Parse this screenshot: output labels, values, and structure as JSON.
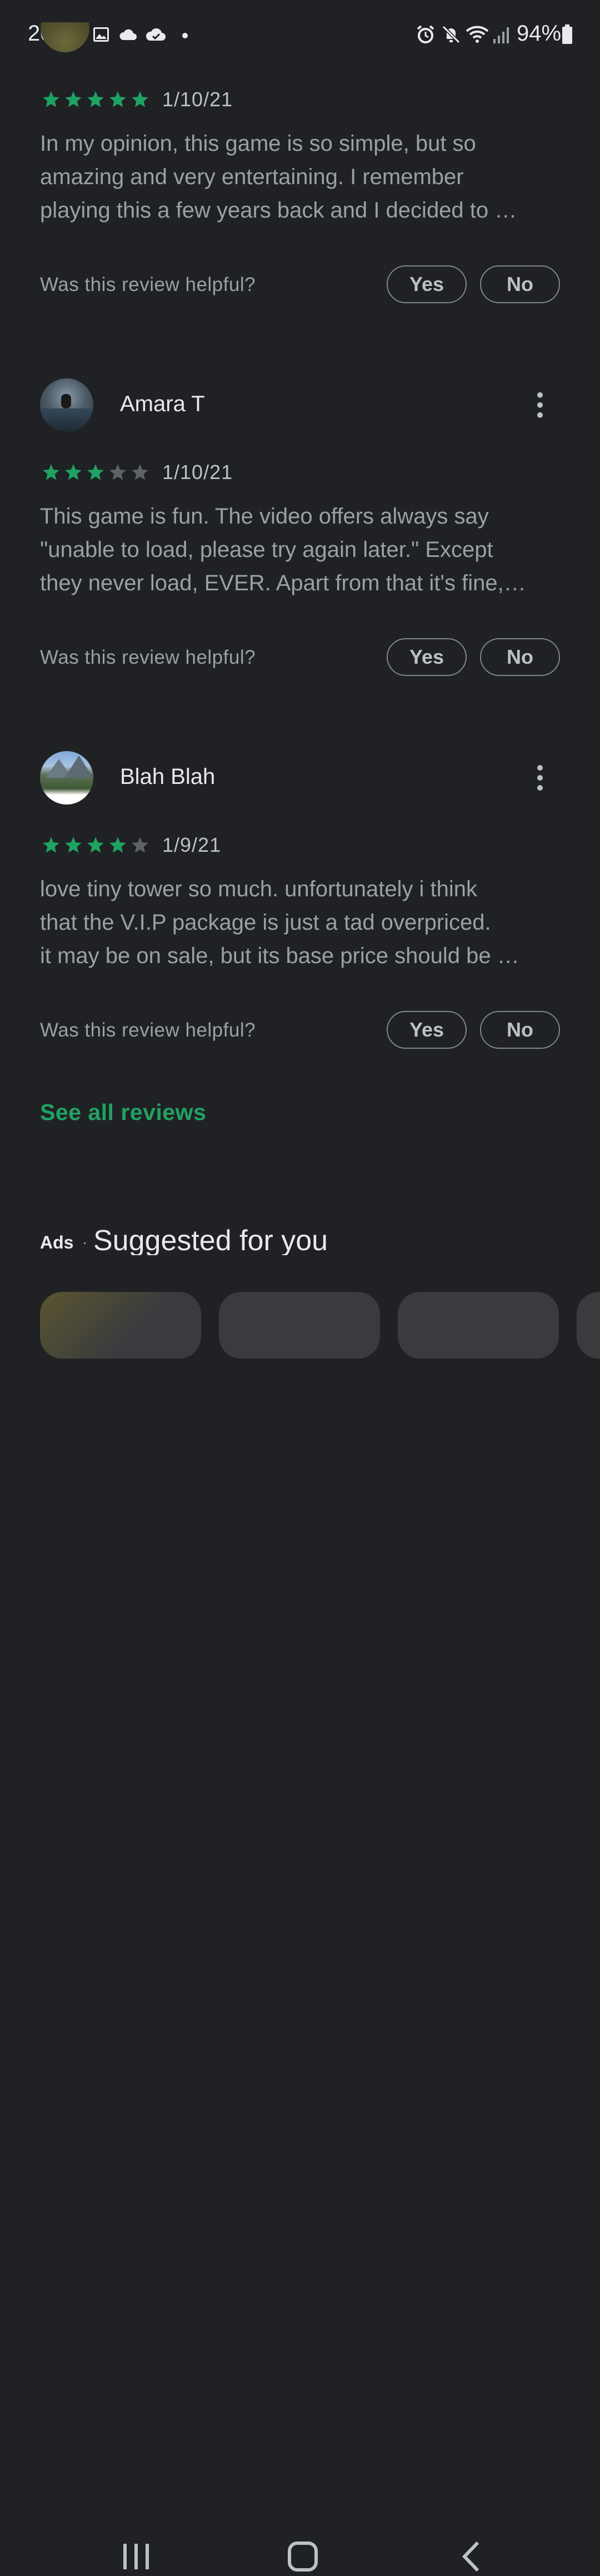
{
  "status_bar": {
    "time": "20:44",
    "battery": "94%",
    "left_icons": [
      "image-icon",
      "cloud-icon",
      "cloud-check-icon",
      "dot-icon"
    ],
    "right_icons": [
      "alarm-icon",
      "mute-icon",
      "wifi-icon",
      "signal-icon",
      "battery-icon"
    ]
  },
  "reviews": [
    {
      "name": "",
      "rating": 5,
      "date": "1/10/21",
      "lines": [
        "In my opinion, this game is so simple, but so",
        "amazing and very entertaining. I remember",
        "playing this a few years back and I decided to …"
      ],
      "helpful_question": "Was this review helpful?",
      "yes_label": "Yes",
      "no_label": "No"
    },
    {
      "name": "Amara T",
      "rating": 3,
      "date": "1/10/21",
      "lines": [
        "This game is fun. The video offers always say",
        "\"unable to load, please try again later.\" Except",
        "they never load, EVER. Apart from that it's fine,…"
      ],
      "helpful_question": "Was this review helpful?",
      "yes_label": "Yes",
      "no_label": "No"
    },
    {
      "name": "Blah Blah",
      "rating": 4,
      "date": "1/9/21",
      "lines": [
        "love tiny tower so much. unfortunately i think",
        "that the V.I.P package is just a tad overpriced.",
        "it may be on sale, but its base price should be …"
      ],
      "helpful_question": "Was this review helpful?",
      "yes_label": "Yes",
      "no_label": "No"
    }
  ],
  "see_all_reviews": "See all reviews",
  "suggested": {
    "ads_label": "Ads",
    "separator": "·",
    "title": "Suggested for you"
  },
  "colors": {
    "background": "#202124",
    "star_filled": "#1ea362",
    "star_empty": "#5f6368",
    "accent": "#1ea362"
  }
}
